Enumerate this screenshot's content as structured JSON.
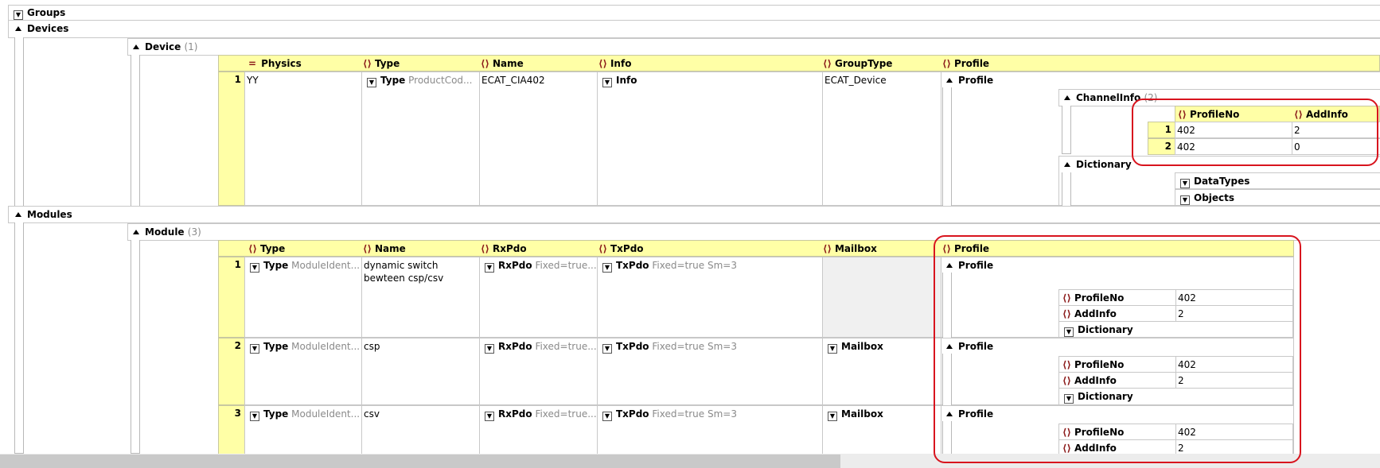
{
  "accent": "#ffffa6",
  "highlight": "#d8141e",
  "sections": {
    "groups": "Groups",
    "devices": "Devices",
    "modules": "Modules"
  },
  "device": {
    "label": "Device",
    "count": "(1)",
    "columns": {
      "physics": "Physics",
      "type": "Type",
      "name": "Name",
      "info": "Info",
      "grouptype": "GroupType",
      "profile": "Profile"
    },
    "row": {
      "num": "1",
      "physics": "YY",
      "type_label": "Type",
      "type_value": "ProductCod...",
      "name": "ECAT_CIA402",
      "info": "Info",
      "grouptype": "ECAT_Device",
      "profile": "Profile"
    },
    "channelinfo": {
      "label": "ChannelInfo",
      "count": "(2)",
      "columns": {
        "profileno": "ProfileNo",
        "addinfo": "AddInfo"
      },
      "rows": [
        {
          "num": "1",
          "profileno": "402",
          "addinfo": "2"
        },
        {
          "num": "2",
          "profileno": "402",
          "addinfo": "0"
        }
      ]
    },
    "dictionary": {
      "label": "Dictionary",
      "datatypes": "DataTypes",
      "objects": "Objects"
    }
  },
  "module": {
    "label": "Module",
    "count": "(3)",
    "columns": {
      "type": "Type",
      "name": "Name",
      "rxpdo": "RxPdo",
      "txpdo": "TxPdo",
      "mailbox": "Mailbox",
      "profile": "Profile"
    },
    "rows": [
      {
        "num": "1",
        "type_label": "Type",
        "type_value": "ModuleIdent...",
        "name": "dynamic switch bewteen csp/csv",
        "rx_label": "RxPdo",
        "rx_value": "Fixed=true...",
        "tx_label": "TxPdo",
        "tx_value": "Fixed=true Sm=3",
        "mailbox": "",
        "profile": "Profile",
        "profileno_label": "ProfileNo",
        "profileno": "402",
        "addinfo_label": "AddInfo",
        "addinfo": "2",
        "dictionary": "Dictionary"
      },
      {
        "num": "2",
        "type_label": "Type",
        "type_value": "ModuleIdent...",
        "name": "csp",
        "rx_label": "RxPdo",
        "rx_value": "Fixed=true...",
        "tx_label": "TxPdo",
        "tx_value": "Fixed=true Sm=3",
        "mailbox": "Mailbox",
        "profile": "Profile",
        "profileno_label": "ProfileNo",
        "profileno": "402",
        "addinfo_label": "AddInfo",
        "addinfo": "2",
        "dictionary": "Dictionary"
      },
      {
        "num": "3",
        "type_label": "Type",
        "type_value": "ModuleIdent...",
        "name": "csv",
        "rx_label": "RxPdo",
        "rx_value": "Fixed=true...",
        "tx_label": "TxPdo",
        "tx_value": "Fixed=true Sm=3",
        "mailbox": "Mailbox",
        "profile": "Profile",
        "profileno_label": "ProfileNo",
        "profileno": "402",
        "addinfo_label": "AddInfo",
        "addinfo": "2"
      }
    ]
  }
}
